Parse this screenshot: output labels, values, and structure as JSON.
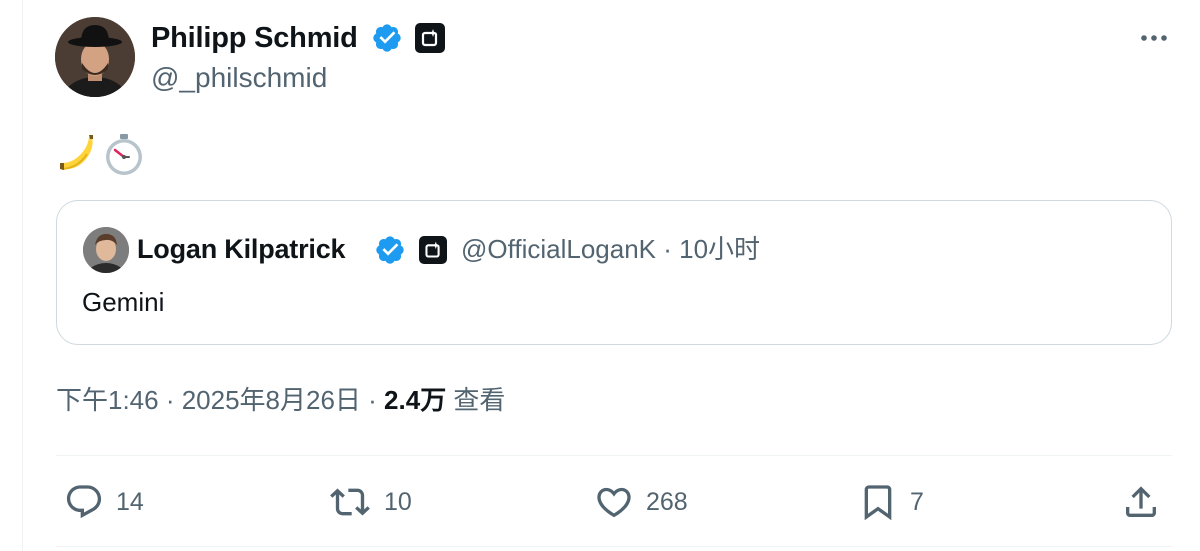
{
  "author": {
    "name": "Philipp Schmid",
    "handle": "@_philschmid"
  },
  "tweet": {
    "emojis": [
      "banana-emoji",
      "stopwatch-emoji"
    ]
  },
  "quote": {
    "name": "Logan Kilpatrick",
    "meta": "@OfficialLoganK · 10小时",
    "text": "Gemini"
  },
  "meta": {
    "timestamp": "下午1:46 · 2025年8月26日 · ",
    "views_count": "2.4万",
    "views_label": " 查看"
  },
  "actions": {
    "reply_count": "14",
    "retweet_count": "10",
    "like_count": "268",
    "bookmark_count": "7"
  },
  "colors": {
    "verified": "#1d9bf0",
    "secondary_text": "#536471",
    "border": "#cfd9de"
  },
  "icons": {
    "verified": "verified-badge-icon",
    "affiliation": "affiliation-badge-icon",
    "more": "more-horizontal-icon",
    "reply": "reply-bubble-icon",
    "retweet": "retweet-icon",
    "like": "heart-icon",
    "bookmark": "bookmark-icon",
    "share": "share-upload-icon"
  }
}
